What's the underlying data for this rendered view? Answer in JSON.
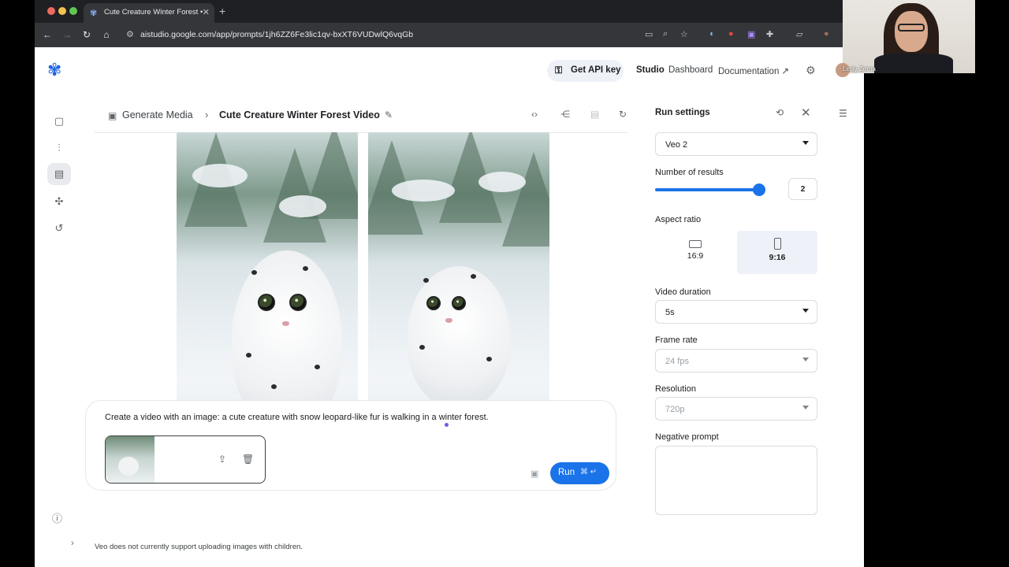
{
  "browser": {
    "tab_title": "Cute Creature Winter Forest •",
    "url": "aistudio.google.com/app/prompts/1jh6ZZ6Fe3lic1qv-bxXT6VUDwlQ6vqGb"
  },
  "header": {
    "api_key_label": "Get API key",
    "nav": [
      "Studio",
      "Dashboard",
      "Documentation ↗"
    ]
  },
  "breadcrumb": {
    "parent": "Generate Media",
    "title": "Cute Creature Winter Forest Video"
  },
  "prompt": {
    "text": "Create a video with an image: a cute creature with snow leopard-like fur is walking in a winter forest.",
    "run_label": "Run",
    "run_shortcut": "⌘ ↵"
  },
  "notice": "Veo does not currently support uploading images with children.",
  "settings": {
    "title": "Run settings",
    "model": "Veo 2",
    "results_label": "Number of results",
    "results_value": "2",
    "results_fraction": 1.0,
    "aspect_label": "Aspect ratio",
    "aspect_options": [
      "16:9",
      "9:16"
    ],
    "aspect_selected": "9:16",
    "duration_label": "Video duration",
    "duration_value": "5s",
    "framerate_label": "Frame rate",
    "framerate_value": "24 fps",
    "resolution_label": "Resolution",
    "resolution_value": "720p",
    "negative_label": "Negative prompt"
  },
  "webcam": {
    "name": "Lesly Zerna"
  },
  "colors": {
    "accent": "#1a73e8",
    "brand": "#1f66e0"
  }
}
